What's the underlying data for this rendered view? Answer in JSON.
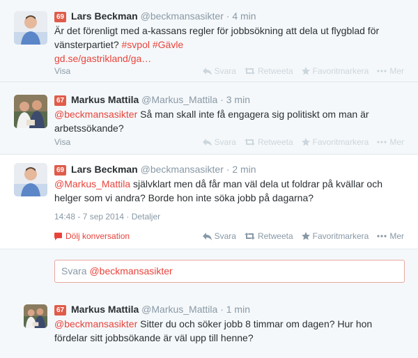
{
  "tweets": [
    {
      "badge": "69",
      "name": "Lars Beckman",
      "handle": "@beckmansasikter",
      "time": "4 min",
      "text_before": "Är det förenligt med a-kassans regler för jobbsökning att dela ut flygblad för vänsterpartiet? ",
      "hashtags": "#svpol #Gävle",
      "link": "gd.se/gastrikland/ga…",
      "visa": "Visa"
    },
    {
      "badge": "67",
      "name": "Markus Mattila",
      "handle": "@Markus_Mattila",
      "time": "3 min",
      "mention": "@beckmansasikter",
      "text": " Så man skall inte få engagera sig politiskt om man är arbetssökande?",
      "visa": "Visa"
    },
    {
      "badge": "69",
      "name": "Lars Beckman",
      "handle": "@beckmansasikter",
      "time": "2 min",
      "mention": "@Markus_Mattila",
      "text": " självklart men då får man väl dela ut foldrar på kvällar och helger som vi andra? Borde hon inte söka jobb på dagarna?",
      "timestamp": "14:48 - 7 sep 2014",
      "details": "Detaljer",
      "hide": "Dölj konversation"
    },
    {
      "badge": "67",
      "name": "Markus Mattila",
      "handle": "@Markus_Mattila",
      "time": "1 min",
      "mention": "@beckmansasikter",
      "text": " Sitter du och söker jobb 8 timmar om dagen? Hur hon fördelar sitt jobbsökande är väl upp till henne?"
    }
  ],
  "actions": {
    "reply": "Svara",
    "retweet": "Retweeta",
    "favorite": "Favoritmarkera",
    "more": "Mer"
  },
  "reply_box": {
    "prefix": "Svara ",
    "mention": "@beckmansasikter"
  },
  "separator": "·",
  "colors": {
    "link": "#e8433b",
    "badge": "#e05c4a",
    "muted": "#8899a6"
  }
}
